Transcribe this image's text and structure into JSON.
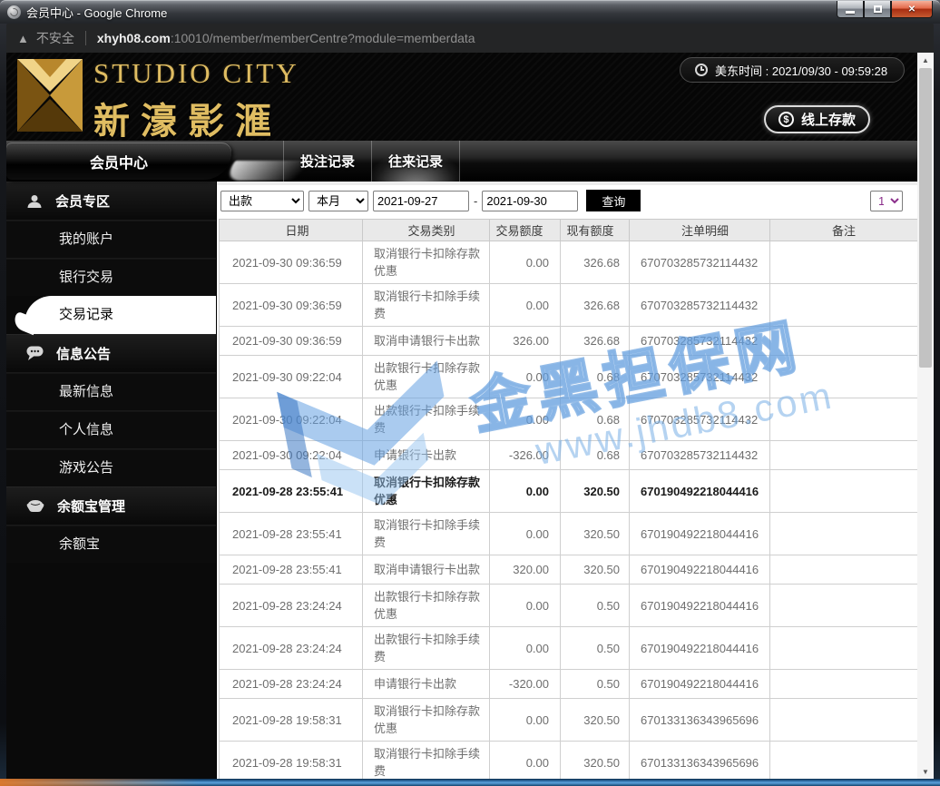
{
  "window": {
    "title": "会员中心 - Google Chrome"
  },
  "browser": {
    "security_warning": "不安全",
    "url_host": "xhyh08.com",
    "url_rest": ":10010/member/memberCentre?module=memberdata"
  },
  "header": {
    "logo_title": "STUDIO CITY",
    "logo_subtitle": "新濠影滙",
    "time_label": "美东时间 : 2021/09/30 - 09:59:28",
    "deposit_button": "线上存款",
    "dollar_glyph": "$"
  },
  "nav": {
    "home_label": "会员中心",
    "tabs": [
      {
        "label": "投注记录",
        "active": false
      },
      {
        "label": "往来记录",
        "active": true
      }
    ]
  },
  "sidebar": {
    "sections": [
      {
        "label": "会员专区",
        "icon": "user",
        "items": [
          {
            "label": "我的账户",
            "active": false
          },
          {
            "label": "银行交易",
            "active": false
          },
          {
            "label": "交易记录",
            "active": true
          }
        ]
      },
      {
        "label": "信息公告",
        "icon": "chat",
        "items": [
          {
            "label": "最新信息",
            "active": false
          },
          {
            "label": "个人信息",
            "active": false
          },
          {
            "label": "游戏公告",
            "active": false
          }
        ]
      },
      {
        "label": "余额宝管理",
        "icon": "ingot",
        "items": [
          {
            "label": "余额宝",
            "active": false
          }
        ]
      }
    ]
  },
  "filters": {
    "type_select": "出款",
    "period_select": "本月",
    "date_from": "2021-09-27",
    "date_separator": "-",
    "date_to": "2021-09-30",
    "search_button": "查询",
    "page_select": "1"
  },
  "table": {
    "headers": [
      "日期",
      "交易类别",
      "交易额度",
      "现有额度",
      "注单明细",
      "备注"
    ],
    "rows": [
      {
        "cells": [
          "2021-09-30 09:36:59",
          "取消银行卡扣除存款优惠",
          "0.00",
          "326.68",
          "670703285732114432",
          ""
        ],
        "bold": false
      },
      {
        "cells": [
          "2021-09-30 09:36:59",
          "取消银行卡扣除手续费",
          "0.00",
          "326.68",
          "670703285732114432",
          ""
        ],
        "bold": false
      },
      {
        "cells": [
          "2021-09-30 09:36:59",
          "取消申请银行卡出款",
          "326.00",
          "326.68",
          "670703285732114432",
          ""
        ],
        "bold": false
      },
      {
        "cells": [
          "2021-09-30 09:22:04",
          "出款银行卡扣除存款优惠",
          "0.00",
          "0.68",
          "670703285732114432",
          ""
        ],
        "bold": false
      },
      {
        "cells": [
          "2021-09-30 09:22:04",
          "出款银行卡扣除手续费",
          "0.00",
          "0.68",
          "670703285732114432",
          ""
        ],
        "bold": false
      },
      {
        "cells": [
          "2021-09-30 09:22:04",
          "申请银行卡出款",
          "-326.00",
          "0.68",
          "670703285732114432",
          ""
        ],
        "bold": false
      },
      {
        "cells": [
          "2021-09-28 23:55:41",
          "取消银行卡扣除存款优惠",
          "0.00",
          "320.50",
          "670190492218044416",
          ""
        ],
        "bold": true
      },
      {
        "cells": [
          "2021-09-28 23:55:41",
          "取消银行卡扣除手续费",
          "0.00",
          "320.50",
          "670190492218044416",
          ""
        ],
        "bold": false
      },
      {
        "cells": [
          "2021-09-28 23:55:41",
          "取消申请银行卡出款",
          "320.00",
          "320.50",
          "670190492218044416",
          ""
        ],
        "bold": false
      },
      {
        "cells": [
          "2021-09-28 23:24:24",
          "出款银行卡扣除存款优惠",
          "0.00",
          "0.50",
          "670190492218044416",
          ""
        ],
        "bold": false
      },
      {
        "cells": [
          "2021-09-28 23:24:24",
          "出款银行卡扣除手续费",
          "0.00",
          "0.50",
          "670190492218044416",
          ""
        ],
        "bold": false
      },
      {
        "cells": [
          "2021-09-28 23:24:24",
          "申请银行卡出款",
          "-320.00",
          "0.50",
          "670190492218044416",
          ""
        ],
        "bold": false
      },
      {
        "cells": [
          "2021-09-28 19:58:31",
          "取消银行卡扣除存款优惠",
          "0.00",
          "320.50",
          "670133136343965696",
          ""
        ],
        "bold": false
      },
      {
        "cells": [
          "2021-09-28 19:58:31",
          "取消银行卡扣除手续费",
          "0.00",
          "320.50",
          "670133136343965696",
          ""
        ],
        "bold": false
      }
    ]
  },
  "watermark": {
    "brand": "金黑担保网",
    "url": "www.jhdb8.com",
    "color": "#5b9bd5"
  },
  "colors": {
    "gold": "#e0bd62",
    "close_button_red": "#c0432b",
    "aero_blue": "#5ba3dd"
  }
}
